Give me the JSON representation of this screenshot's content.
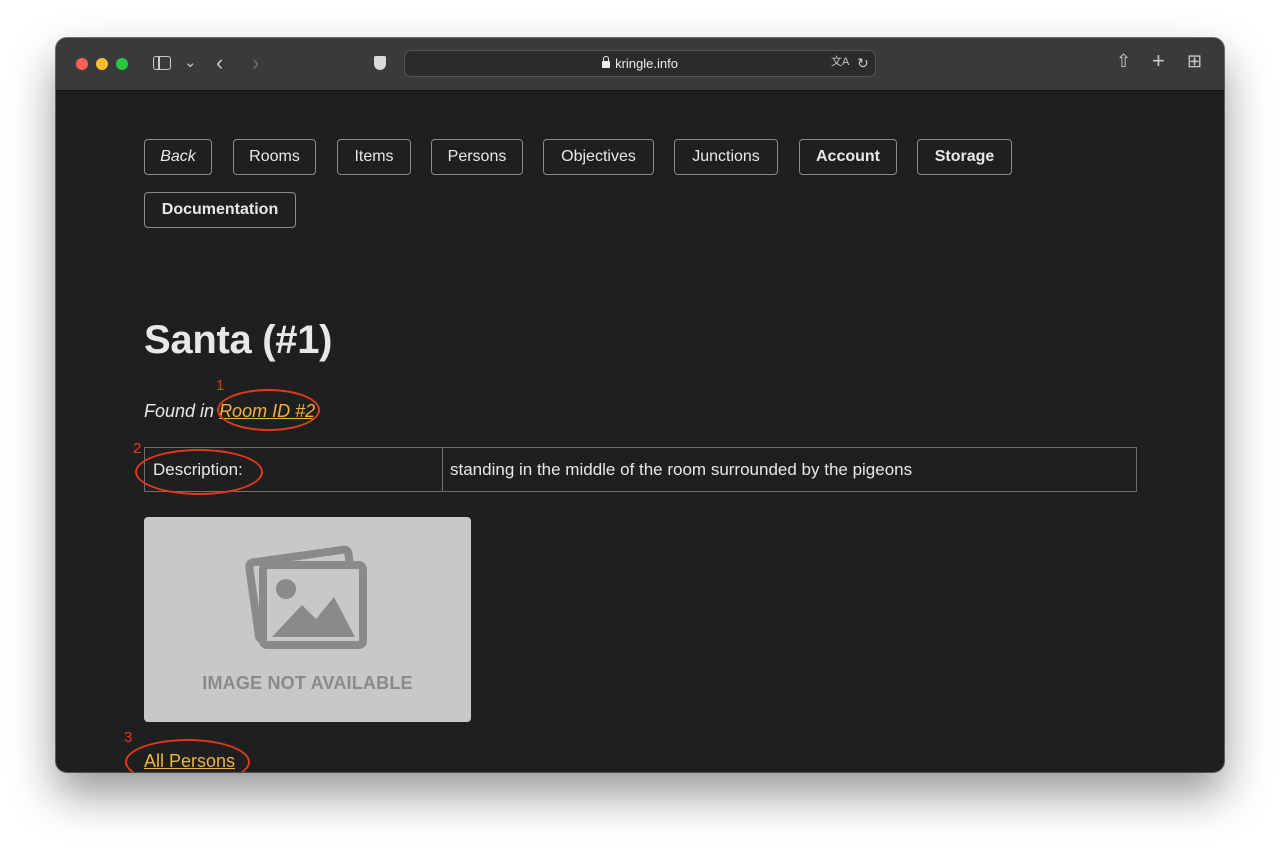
{
  "browser": {
    "url": "kringle.info",
    "buttons": {
      "sidebar": "sidebar-toggle",
      "back": "‹",
      "forward": "›",
      "chevron": "⌄",
      "reload": "↻",
      "translate": "文A",
      "share": "⇧",
      "new_tab": "+",
      "tab_overview": "⊞"
    }
  },
  "nav": {
    "items": [
      {
        "label": "Back",
        "style": "italic"
      },
      {
        "label": "Rooms"
      },
      {
        "label": "Items"
      },
      {
        "label": "Persons"
      },
      {
        "label": "Objectives"
      },
      {
        "label": "Junctions"
      },
      {
        "label": "Account",
        "style": "bold"
      },
      {
        "label": "Storage",
        "style": "bold"
      },
      {
        "label": "Documentation",
        "style": "bold"
      }
    ]
  },
  "page": {
    "title": "Santa (#1)",
    "found_prefix": "Found in ",
    "room_link": "Room ID #2",
    "description_label": "Description:",
    "description_value": "standing in the middle of the room surrounded by the pigeons",
    "image_caption": "IMAGE NOT AVAILABLE",
    "all_persons_link": "All Persons"
  },
  "annotations": {
    "labels": [
      "1",
      "2",
      "3"
    ],
    "color": "#e0391c"
  },
  "colors": {
    "link": "#f0b43a",
    "background": "#1f1f1f",
    "text": "#e8e8e8"
  }
}
